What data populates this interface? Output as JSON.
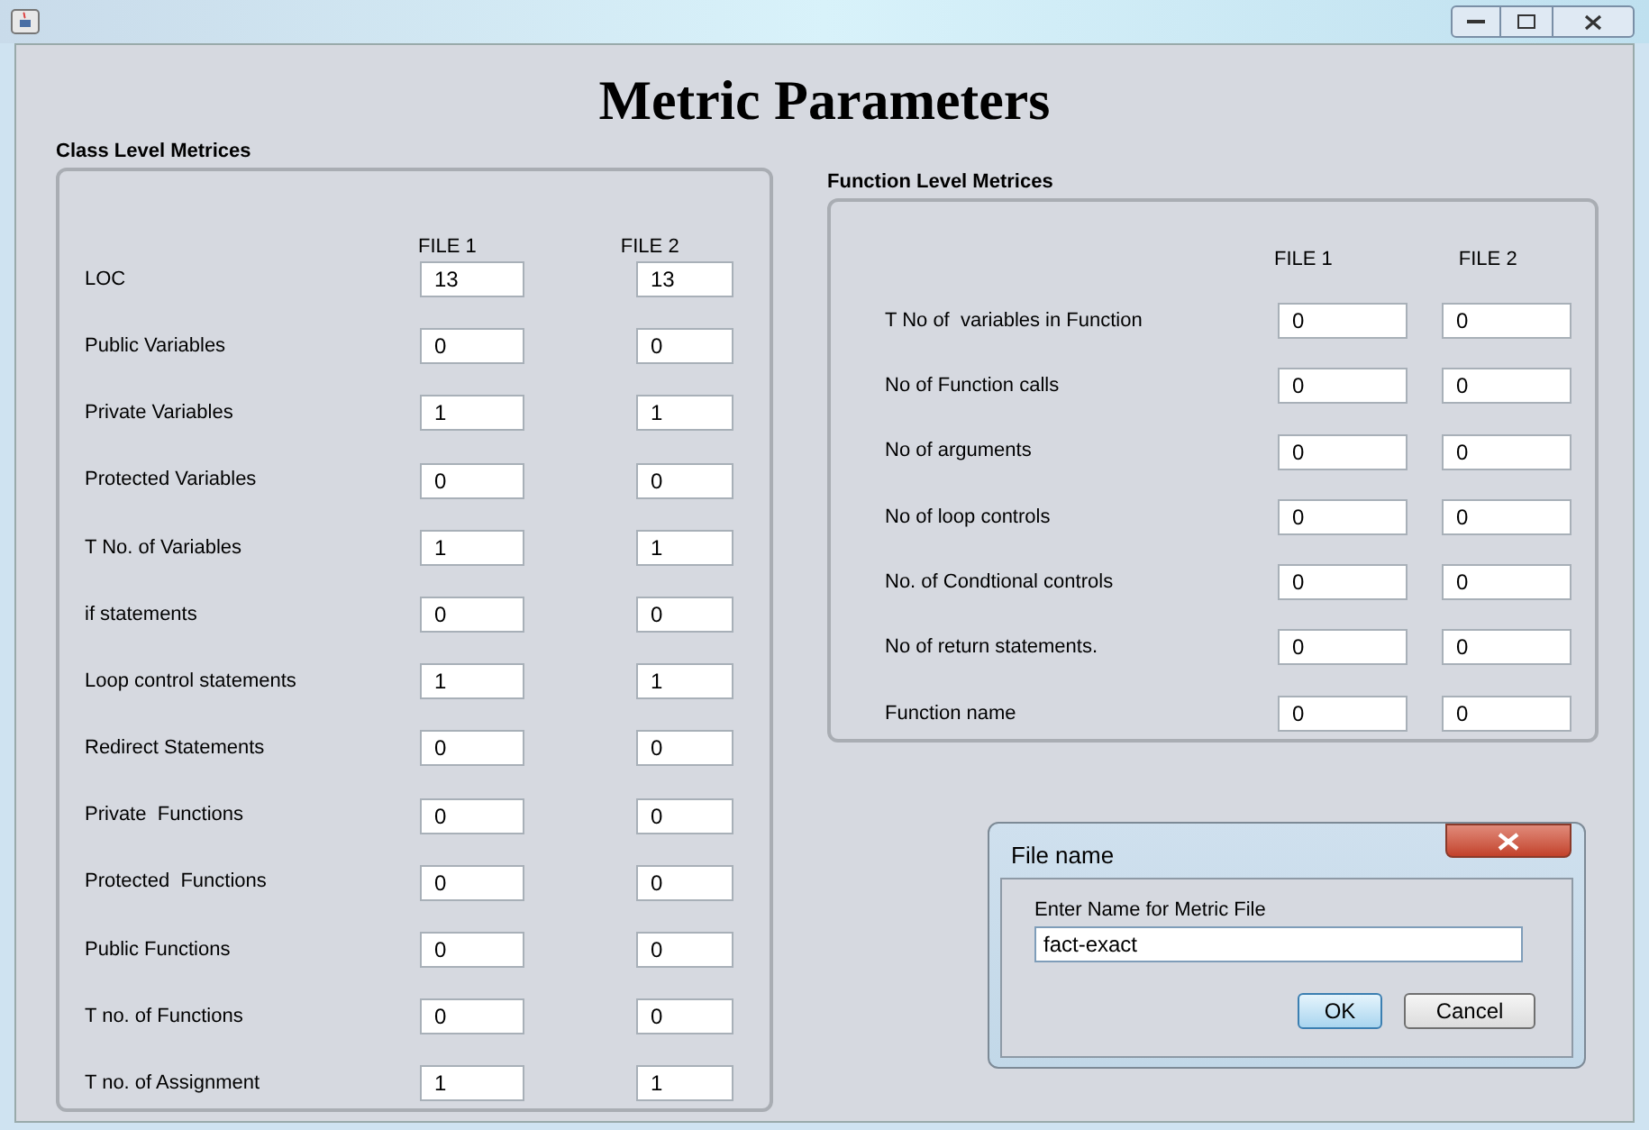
{
  "heading": "Metric Parameters",
  "class_panel": {
    "title": "Class Level Metrices",
    "columns": [
      "FILE 1",
      "FILE 2"
    ],
    "rows": [
      {
        "label": "LOC",
        "file1": "13",
        "file2": "13"
      },
      {
        "label": "Public Variables",
        "file1": "0",
        "file2": "0"
      },
      {
        "label": "Private Variables",
        "file1": "1",
        "file2": "1"
      },
      {
        "label": "Protected Variables",
        "file1": "0",
        "file2": "0"
      },
      {
        "label": "T No. of Variables",
        "file1": "1",
        "file2": "1"
      },
      {
        "label": "if statements",
        "file1": "0",
        "file2": "0"
      },
      {
        "label": "Loop control statements",
        "file1": "1",
        "file2": "1"
      },
      {
        "label": "Redirect Statements",
        "file1": "0",
        "file2": "0"
      },
      {
        "label": "Private  Functions",
        "file1": "0",
        "file2": "0"
      },
      {
        "label": "Protected  Functions",
        "file1": "0",
        "file2": "0"
      },
      {
        "label": "Public Functions",
        "file1": "0",
        "file2": "0"
      },
      {
        "label": "T no. of Functions",
        "file1": "0",
        "file2": "0"
      },
      {
        "label": "T no. of Assignment",
        "file1": "1",
        "file2": "1"
      }
    ]
  },
  "function_panel": {
    "title": "Function Level Metrices",
    "columns": [
      "FILE 1",
      "FILE 2"
    ],
    "rows": [
      {
        "label": "T No of  variables in Function",
        "file1": "0",
        "file2": "0"
      },
      {
        "label": "No of Function calls",
        "file1": "0",
        "file2": "0"
      },
      {
        "label": "No of arguments",
        "file1": "0",
        "file2": "0"
      },
      {
        "label": "No of loop controls",
        "file1": "0",
        "file2": "0"
      },
      {
        "label": "No. of Condtional controls",
        "file1": "0",
        "file2": "0"
      },
      {
        "label": "No of return statements.",
        "file1": "0",
        "file2": "0"
      },
      {
        "label": "Function name",
        "file1": "0",
        "file2": "0"
      }
    ]
  },
  "dialog": {
    "title": "File name",
    "prompt": "Enter Name for Metric File",
    "value": "fact-exact",
    "buttons": [
      "OK",
      "Cancel"
    ]
  }
}
